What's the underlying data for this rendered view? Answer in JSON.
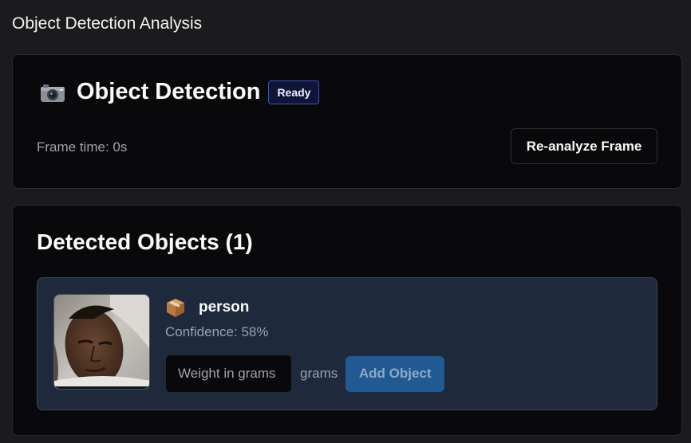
{
  "page": {
    "title": "Object Detection Analysis"
  },
  "detection_card": {
    "title": "Object Detection",
    "status": "Ready",
    "frame_time": "Frame time: 0s",
    "reanalyze_label": "Re-analyze Frame",
    "icon": "camera-icon"
  },
  "detected_card": {
    "title": "Detected Objects (1)",
    "objects": [
      {
        "name": "person",
        "icon": "package-icon",
        "confidence": "Confidence: 58%",
        "weight_placeholder": "Weight in grams",
        "weight_unit": "grams",
        "add_label": "Add Object"
      }
    ]
  },
  "colors": {
    "background": "#1b1b1d",
    "card": "#09090b",
    "object_item": "#1e293b",
    "badge_border": "#3b4fcf",
    "add_button": "#215a92"
  }
}
